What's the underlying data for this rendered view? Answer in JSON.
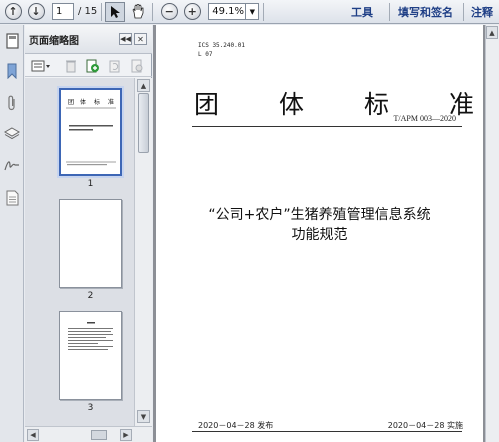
{
  "toolbar": {
    "page_current": "1",
    "page_total": "/ 15",
    "zoom": "49.1%",
    "tools_label": "工具",
    "sign_label": "填写和签名",
    "comment_label": "注释"
  },
  "panel": {
    "title": "页面缩略图",
    "thumbnails": [
      {
        "label": "1"
      },
      {
        "label": "2"
      },
      {
        "label": "3"
      }
    ]
  },
  "document": {
    "ics": "ICS 35.240.01",
    "ccs": "L 07",
    "big_title_chars": [
      "团",
      "体",
      "标",
      "准"
    ],
    "standard_no": "T/APM 003—2020",
    "main_title": "“公司+农户”生猪养殖管理信息系统",
    "sub_title": "功能规范",
    "publish": "2020－04－28 发布",
    "implement": "2020－04－28 实施"
  },
  "colors": {
    "accent": "#1f3f86",
    "selection": "#3d66b5"
  }
}
